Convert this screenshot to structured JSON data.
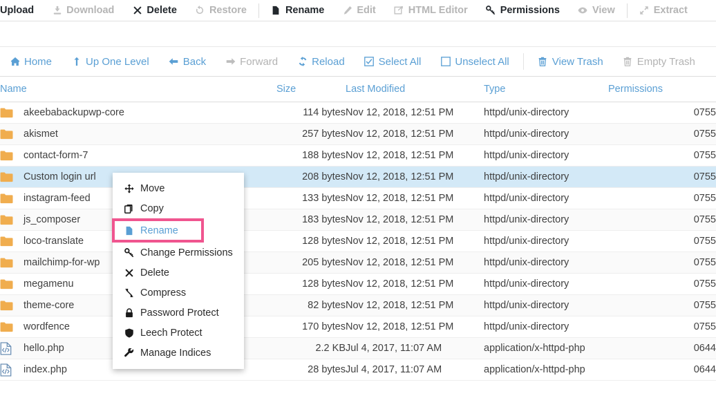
{
  "top_toolbar": {
    "items": [
      {
        "label": "Upload",
        "icon": "upload-icon",
        "disabled": false,
        "icon_hidden": true
      },
      {
        "label": "Download",
        "icon": "download-icon",
        "disabled": true
      },
      {
        "label": "Delete",
        "icon": "x-mark-icon",
        "disabled": false
      },
      {
        "label": "Restore",
        "icon": "restore-icon",
        "disabled": true
      },
      {
        "sep": true
      },
      {
        "label": "Rename",
        "icon": "file-icon",
        "disabled": false
      },
      {
        "label": "Edit",
        "icon": "pencil-icon",
        "disabled": true
      },
      {
        "label": "HTML Editor",
        "icon": "html-editor-icon",
        "disabled": true
      },
      {
        "label": "Permissions",
        "icon": "key-icon",
        "disabled": false
      },
      {
        "label": "View",
        "icon": "eye-icon",
        "disabled": true
      },
      {
        "sep": true
      },
      {
        "label": "Extract",
        "icon": "extract-icon",
        "disabled": true
      }
    ]
  },
  "nav_toolbar": {
    "items": [
      {
        "label": "Home",
        "icon": "home-icon",
        "disabled": false
      },
      {
        "label": "Up One Level",
        "icon": "arrow-up-icon",
        "disabled": false
      },
      {
        "label": "Back",
        "icon": "arrow-left-icon",
        "disabled": false
      },
      {
        "label": "Forward",
        "icon": "arrow-right-icon",
        "disabled": true
      },
      {
        "label": "Reload",
        "icon": "reload-icon",
        "disabled": false
      },
      {
        "label": "Select All",
        "icon": "checkbox-checked-icon",
        "disabled": false
      },
      {
        "label": "Unselect All",
        "icon": "checkbox-empty-icon",
        "disabled": false
      },
      {
        "sep": true
      },
      {
        "label": "View Trash",
        "icon": "trash-icon",
        "disabled": false
      },
      {
        "label": "Empty Trash",
        "icon": "trash-icon",
        "disabled": true
      }
    ]
  },
  "table": {
    "columns": [
      "Name",
      "Size",
      "Last Modified",
      "Type",
      "Permissions"
    ],
    "rows": [
      {
        "name": "akeebabackupwp-core",
        "icon": "folder-icon",
        "size": "114 bytes",
        "modified": "Nov 12, 2018, 12:51 PM",
        "type": "httpd/unix-directory",
        "permissions": "0755",
        "selected": false
      },
      {
        "name": "akismet",
        "icon": "folder-icon",
        "size": "257 bytes",
        "modified": "Nov 12, 2018, 12:51 PM",
        "type": "httpd/unix-directory",
        "permissions": "0755",
        "selected": false
      },
      {
        "name": "contact-form-7",
        "icon": "folder-icon",
        "size": "188 bytes",
        "modified": "Nov 12, 2018, 12:51 PM",
        "type": "httpd/unix-directory",
        "permissions": "0755",
        "selected": false
      },
      {
        "name": "Custom login url",
        "icon": "folder-icon",
        "size": "208 bytes",
        "modified": "Nov 12, 2018, 12:51 PM",
        "type": "httpd/unix-directory",
        "permissions": "0755",
        "selected": true
      },
      {
        "name": "instagram-feed",
        "icon": "folder-icon",
        "size": "133 bytes",
        "modified": "Nov 12, 2018, 12:51 PM",
        "type": "httpd/unix-directory",
        "permissions": "0755",
        "selected": false
      },
      {
        "name": "js_composer",
        "icon": "folder-icon",
        "size": "183 bytes",
        "modified": "Nov 12, 2018, 12:51 PM",
        "type": "httpd/unix-directory",
        "permissions": "0755",
        "selected": false
      },
      {
        "name": "loco-translate",
        "icon": "folder-icon",
        "size": "128 bytes",
        "modified": "Nov 12, 2018, 12:51 PM",
        "type": "httpd/unix-directory",
        "permissions": "0755",
        "selected": false
      },
      {
        "name": "mailchimp-for-wp",
        "icon": "folder-icon",
        "size": "205 bytes",
        "modified": "Nov 12, 2018, 12:51 PM",
        "type": "httpd/unix-directory",
        "permissions": "0755",
        "selected": false
      },
      {
        "name": "megamenu",
        "icon": "folder-icon",
        "size": "128 bytes",
        "modified": "Nov 12, 2018, 12:51 PM",
        "type": "httpd/unix-directory",
        "permissions": "0755",
        "selected": false
      },
      {
        "name": "theme-core",
        "icon": "folder-icon",
        "size": "82 bytes",
        "modified": "Nov 12, 2018, 12:51 PM",
        "type": "httpd/unix-directory",
        "permissions": "0755",
        "selected": false
      },
      {
        "name": "wordfence",
        "icon": "folder-icon",
        "size": "170 bytes",
        "modified": "Nov 12, 2018, 12:51 PM",
        "type": "httpd/unix-directory",
        "permissions": "0755",
        "selected": false
      },
      {
        "name": "hello.php",
        "icon": "php-file-icon",
        "size": "2.2 KB",
        "modified": "Jul 4, 2017, 11:07 AM",
        "type": "application/x-httpd-php",
        "permissions": "0644",
        "selected": false
      },
      {
        "name": "index.php",
        "icon": "php-file-icon",
        "size": "28 bytes",
        "modified": "Jul 4, 2017, 11:07 AM",
        "type": "application/x-httpd-php",
        "permissions": "0644",
        "selected": false
      }
    ]
  },
  "context_menu": {
    "items": [
      {
        "label": "Move",
        "icon": "move-arrows-icon",
        "highlighted": false
      },
      {
        "label": "Copy",
        "icon": "copy-icon",
        "highlighted": false
      },
      {
        "label": "Rename",
        "icon": "file-icon",
        "highlighted": true
      },
      {
        "label": "Change Permissions",
        "icon": "key-icon",
        "highlighted": false
      },
      {
        "label": "Delete",
        "icon": "x-mark-icon",
        "highlighted": false
      },
      {
        "label": "Compress",
        "icon": "compress-icon",
        "highlighted": false
      },
      {
        "label": "Password Protect",
        "icon": "lock-icon",
        "highlighted": false
      },
      {
        "label": "Leech Protect",
        "icon": "shield-icon",
        "highlighted": false
      },
      {
        "label": "Manage Indices",
        "icon": "wrench-icon",
        "highlighted": false
      }
    ]
  },
  "colors": {
    "link": "#5a9fd4",
    "folder": "#f0ad4e",
    "selected_row": "#d3e9f7",
    "highlight_border": "#f0558f",
    "disabled_text": "#b5b5b5"
  }
}
